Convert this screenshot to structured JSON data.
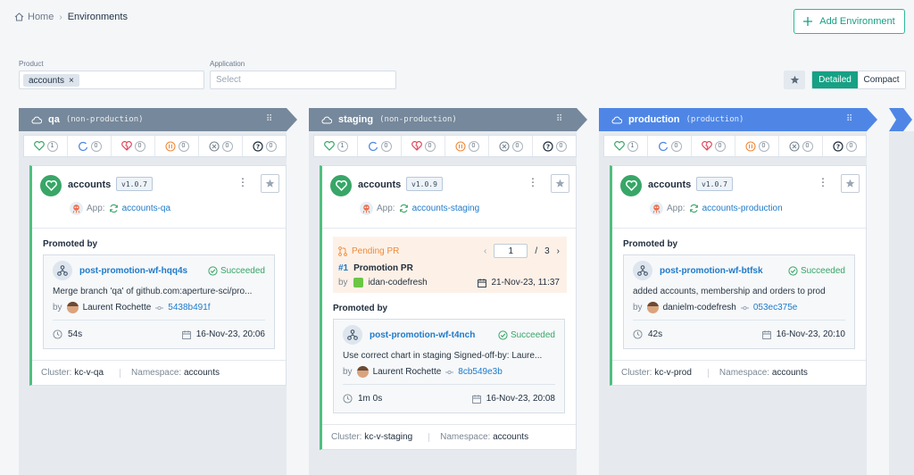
{
  "breadcrumb": {
    "home": "Home",
    "current": "Environments"
  },
  "add_button": "Add Environment",
  "filters": {
    "product_label": "Product",
    "product_chip": "accounts",
    "application_label": "Application",
    "application_placeholder": "Select"
  },
  "view_toggle": {
    "detailed": "Detailed",
    "compact": "Compact",
    "selected": "Detailed"
  },
  "colors": {
    "accent": "#16a084",
    "non_production": "#76889b",
    "production": "#4f86e6",
    "healthy": "#38a667",
    "pending": "#ee8a3a",
    "link": "#1f7ac9"
  },
  "environments": [
    {
      "name": "qa",
      "kind": "(non-production)",
      "stats": [
        "1",
        "0",
        "0",
        "0",
        "0",
        "0"
      ],
      "app": {
        "name": "accounts",
        "version": "v1.0.7",
        "app_label": "App:",
        "app_link": "accounts-qa"
      },
      "promoted_by": "Promoted by",
      "workflow": {
        "name": "post-promotion-wf-hqq4s",
        "status": "Succeeded",
        "message": "Merge branch 'qa' of github.com:aperture-sci/pro...",
        "by": "by",
        "author": "Laurent Rochette",
        "sha": "5438b491f",
        "duration": "54s",
        "date": "16-Nov-23, 20:06"
      },
      "cluster_label": "Cluster:",
      "cluster": "kc-v-qa",
      "namespace_label": "Namespace:",
      "namespace": "accounts"
    },
    {
      "name": "staging",
      "kind": "(non-production)",
      "stats": [
        "1",
        "0",
        "0",
        "0",
        "0",
        "0"
      ],
      "app": {
        "name": "accounts",
        "version": "v1.0.9",
        "app_label": "App:",
        "app_link": "accounts-staging"
      },
      "pending_pr": {
        "label": "Pending PR",
        "page": "1",
        "of": "/",
        "total": "3",
        "number": "#1",
        "title": "Promotion PR",
        "by": "by",
        "author": "idan-codefresh",
        "date": "21-Nov-23, 11:37"
      },
      "promoted_by": "Promoted by",
      "workflow": {
        "name": "post-promotion-wf-t4nch",
        "status": "Succeeded",
        "message": "Use correct chart in staging Signed-off-by: Laure...",
        "by": "by",
        "author": "Laurent Rochette",
        "sha": "8cb549e3b",
        "duration": "1m 0s",
        "date": "16-Nov-23, 20:08"
      },
      "cluster_label": "Cluster:",
      "cluster": "kc-v-staging",
      "namespace_label": "Namespace:",
      "namespace": "accounts"
    },
    {
      "name": "production",
      "kind": "(production)",
      "stats": [
        "1",
        "0",
        "0",
        "0",
        "0",
        "0"
      ],
      "app": {
        "name": "accounts",
        "version": "v1.0.7",
        "app_label": "App:",
        "app_link": "accounts-production"
      },
      "promoted_by": "Promoted by",
      "workflow": {
        "name": "post-promotion-wf-btfsk",
        "status": "Succeeded",
        "message": "added accounts, membership and orders to prod",
        "by": "by",
        "author": "danielm-codefresh",
        "sha": "053ec375e",
        "duration": "42s",
        "date": "16-Nov-23, 20:10"
      },
      "cluster_label": "Cluster:",
      "cluster": "kc-v-prod",
      "namespace_label": "Namespace:",
      "namespace": "accounts"
    }
  ]
}
